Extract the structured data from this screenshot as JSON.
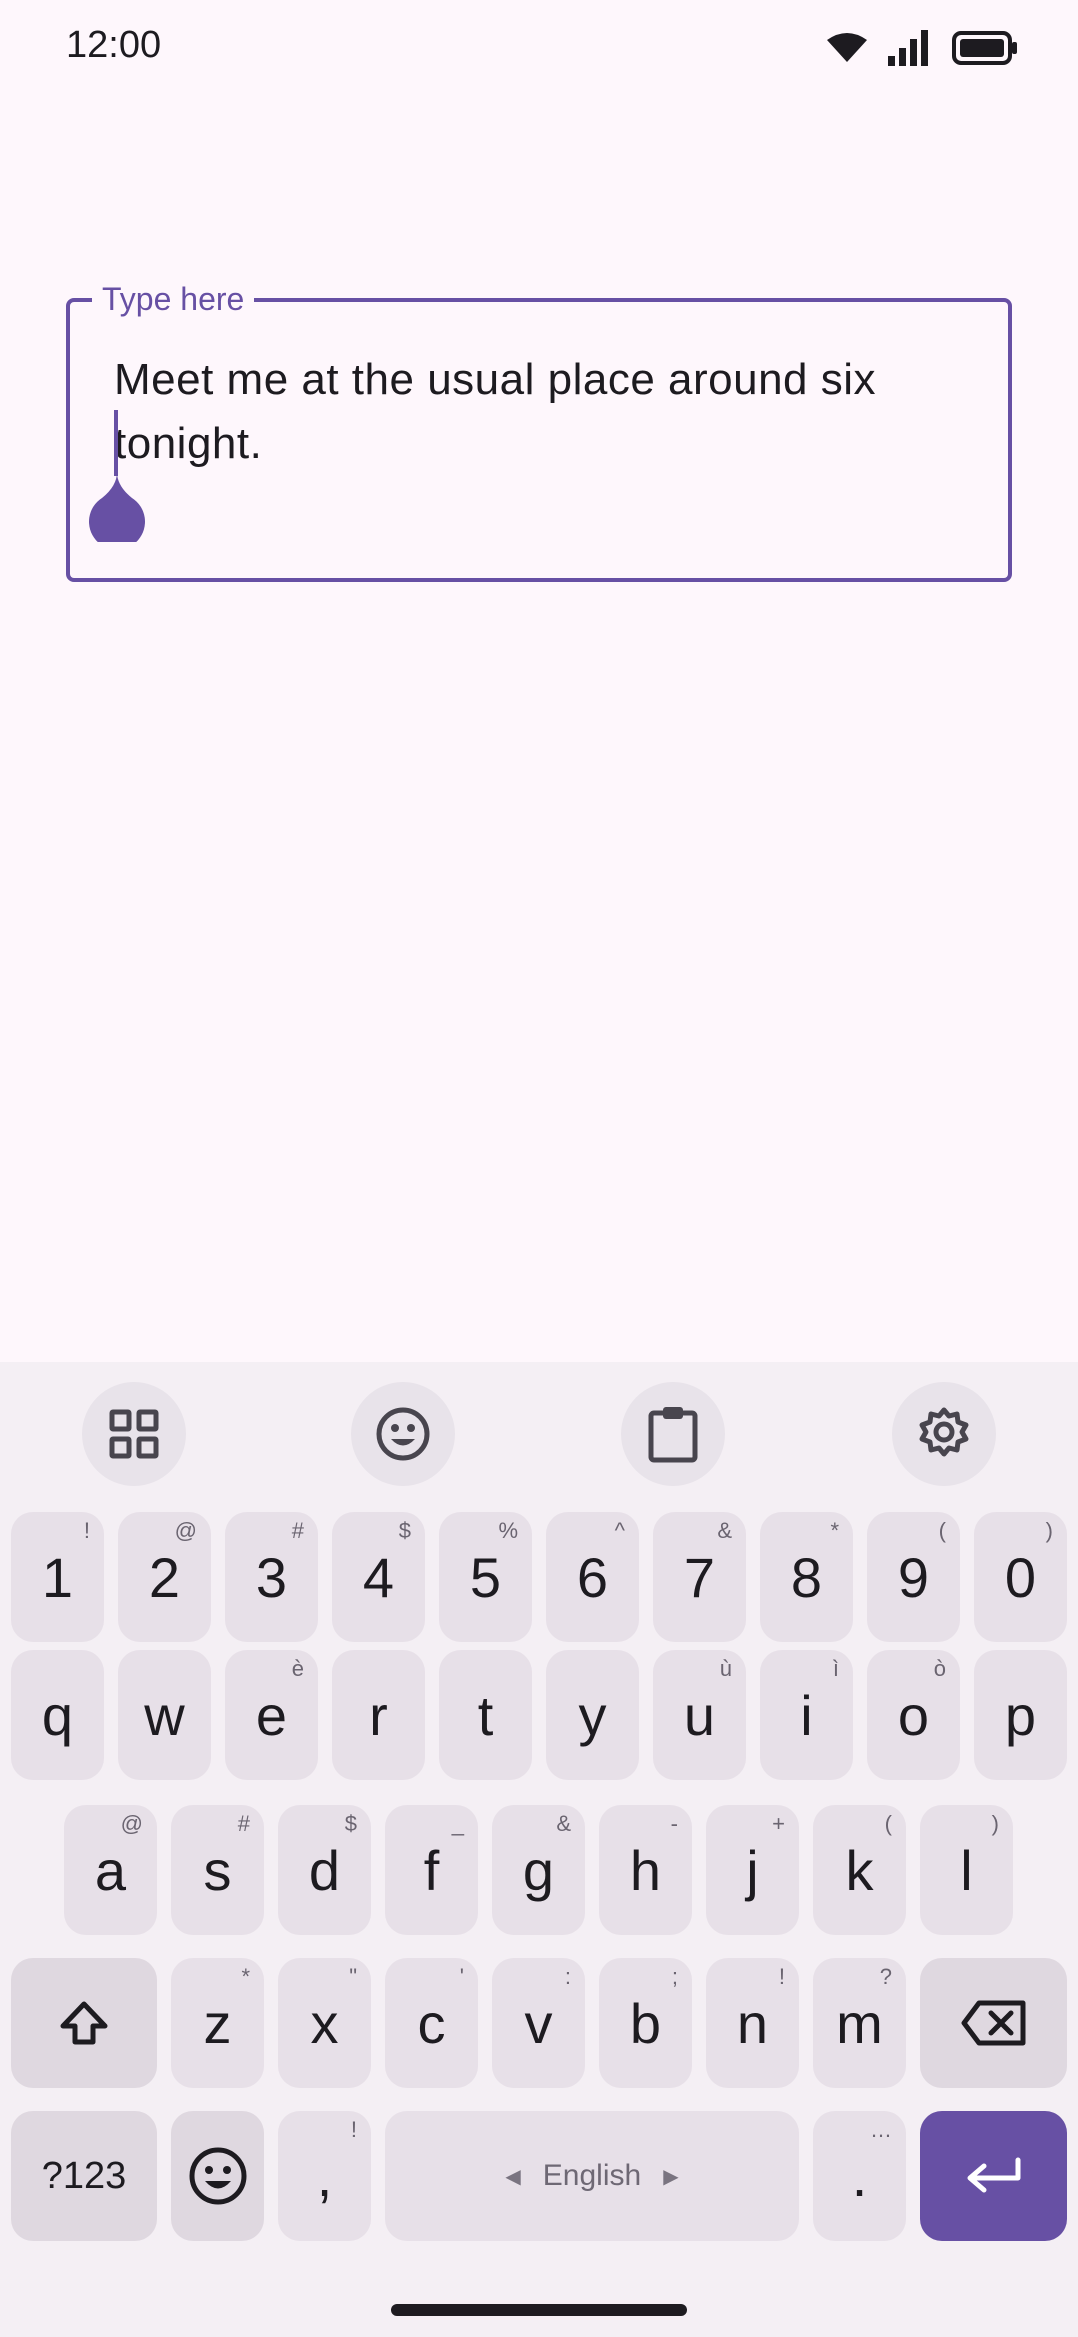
{
  "status_bar": {
    "time": "12:00"
  },
  "text_field": {
    "label": "Type here",
    "value": "Meet me at the usual place around six tonight."
  },
  "keyboard": {
    "toolbar": [
      "grid-icon",
      "emoji-icon",
      "clipboard-icon",
      "settings-icon"
    ],
    "number_row": [
      {
        "key": "1",
        "hint": "!"
      },
      {
        "key": "2",
        "hint": "@"
      },
      {
        "key": "3",
        "hint": "#"
      },
      {
        "key": "4",
        "hint": "$"
      },
      {
        "key": "5",
        "hint": "%"
      },
      {
        "key": "6",
        "hint": "^"
      },
      {
        "key": "7",
        "hint": "&"
      },
      {
        "key": "8",
        "hint": "*"
      },
      {
        "key": "9",
        "hint": "("
      },
      {
        "key": "0",
        "hint": ")"
      }
    ],
    "row1": [
      {
        "key": "q",
        "hint": ""
      },
      {
        "key": "w",
        "hint": ""
      },
      {
        "key": "e",
        "hint": "è"
      },
      {
        "key": "r",
        "hint": ""
      },
      {
        "key": "t",
        "hint": ""
      },
      {
        "key": "y",
        "hint": ""
      },
      {
        "key": "u",
        "hint": "ù"
      },
      {
        "key": "i",
        "hint": "ì"
      },
      {
        "key": "o",
        "hint": "ò"
      },
      {
        "key": "p",
        "hint": ""
      }
    ],
    "row2": [
      {
        "key": "a",
        "hint": "@"
      },
      {
        "key": "s",
        "hint": "#"
      },
      {
        "key": "d",
        "hint": "$"
      },
      {
        "key": "f",
        "hint": "_"
      },
      {
        "key": "g",
        "hint": "&"
      },
      {
        "key": "h",
        "hint": "-"
      },
      {
        "key": "j",
        "hint": "+"
      },
      {
        "key": "k",
        "hint": "("
      },
      {
        "key": "l",
        "hint": ")"
      }
    ],
    "row3": [
      {
        "key": "z",
        "hint": "*"
      },
      {
        "key": "x",
        "hint": "\""
      },
      {
        "key": "c",
        "hint": "'"
      },
      {
        "key": "v",
        "hint": ":"
      },
      {
        "key": "b",
        "hint": ";"
      },
      {
        "key": "n",
        "hint": "!"
      },
      {
        "key": "m",
        "hint": "?"
      }
    ],
    "bottom": {
      "symbols": "?123",
      "comma": ",",
      "comma_hint": "!",
      "space": "English",
      "period": ".",
      "period_hint": "…"
    }
  }
}
